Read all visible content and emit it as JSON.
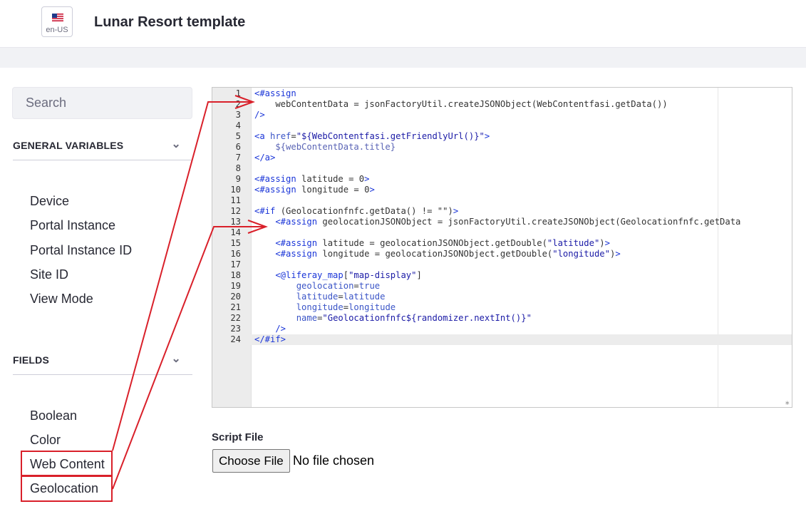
{
  "header": {
    "locale": "en-US",
    "title": "Lunar Resort template"
  },
  "sidebar": {
    "search_placeholder": "Search",
    "general_variables": {
      "label": "GENERAL VARIABLES",
      "items": [
        "Device",
        "Portal Instance",
        "Portal Instance ID",
        "Site ID",
        "View Mode"
      ]
    },
    "fields": {
      "label": "FIELDS",
      "items": [
        "Boolean",
        "Color",
        "Web Content",
        "Geolocation"
      ]
    }
  },
  "editor": {
    "active_line": 24,
    "lines": [
      [
        [
          "tag",
          "<#assign"
        ]
      ],
      [
        [
          "plain",
          "    webContentData = jsonFactoryUtil.createJSONObject(WebContentfasi.getData())"
        ]
      ],
      [
        [
          "tag",
          "/>"
        ]
      ],
      [],
      [
        [
          "tag",
          "<a "
        ],
        [
          "attr",
          "href"
        ],
        [
          "plain",
          "="
        ],
        [
          "str",
          "\"${WebContentfasi.getFriendlyUrl()}\""
        ],
        [
          "tag",
          ">"
        ]
      ],
      [
        [
          "var",
          "    ${webContentData.title}"
        ]
      ],
      [
        [
          "tag",
          "</a>"
        ]
      ],
      [],
      [
        [
          "tag",
          "<#assign "
        ],
        [
          "plain",
          "latitude = 0"
        ],
        [
          "tag",
          ">"
        ]
      ],
      [
        [
          "tag",
          "<#assign "
        ],
        [
          "plain",
          "longitude = 0"
        ],
        [
          "tag",
          ">"
        ]
      ],
      [],
      [
        [
          "tag",
          "<#if "
        ],
        [
          "plain",
          "(Geolocationfnfc.getData() != \"\")"
        ],
        [
          "tag",
          ">"
        ]
      ],
      [
        [
          "tag",
          "    <#assign "
        ],
        [
          "plain",
          "geolocationJSONObject = jsonFactoryUtil.createJSONObject(Geolocationfnfc.getData"
        ]
      ],
      [],
      [
        [
          "tag",
          "    <#assign "
        ],
        [
          "plain",
          "latitude = geolocationJSONObject.getDouble("
        ],
        [
          "str",
          "\"latitude\""
        ],
        [
          "plain",
          ")"
        ],
        [
          "tag",
          ">"
        ]
      ],
      [
        [
          "tag",
          "    <#assign "
        ],
        [
          "plain",
          "longitude = geolocationJSONObject.getDouble("
        ],
        [
          "str",
          "\"longitude\""
        ],
        [
          "plain",
          ")"
        ],
        [
          "tag",
          ">"
        ]
      ],
      [],
      [
        [
          "tag",
          "    <@liferay_map"
        ],
        [
          "plain",
          "["
        ],
        [
          "str",
          "\"map-display\""
        ],
        [
          "plain",
          "]"
        ]
      ],
      [
        [
          "attr",
          "        geolocation"
        ],
        [
          "plain",
          "="
        ],
        [
          "attr",
          "true"
        ]
      ],
      [
        [
          "attr",
          "        latitude"
        ],
        [
          "plain",
          "="
        ],
        [
          "attr",
          "latitude"
        ]
      ],
      [
        [
          "attr",
          "        longitude"
        ],
        [
          "plain",
          "="
        ],
        [
          "attr",
          "longitude"
        ]
      ],
      [
        [
          "attr",
          "        name"
        ],
        [
          "plain",
          "="
        ],
        [
          "str",
          "\"Geolocationfnfc${randomizer.nextInt()}\""
        ]
      ],
      [
        [
          "tag",
          "    />"
        ]
      ],
      [
        [
          "tag",
          "</#if>"
        ]
      ]
    ]
  },
  "script_file": {
    "label": "Script File",
    "button_label": "Choose File",
    "status": "No file chosen"
  },
  "colors": {
    "highlight": "#d9202a",
    "tag": "#1a35d8",
    "string": "#1a1aa6"
  }
}
